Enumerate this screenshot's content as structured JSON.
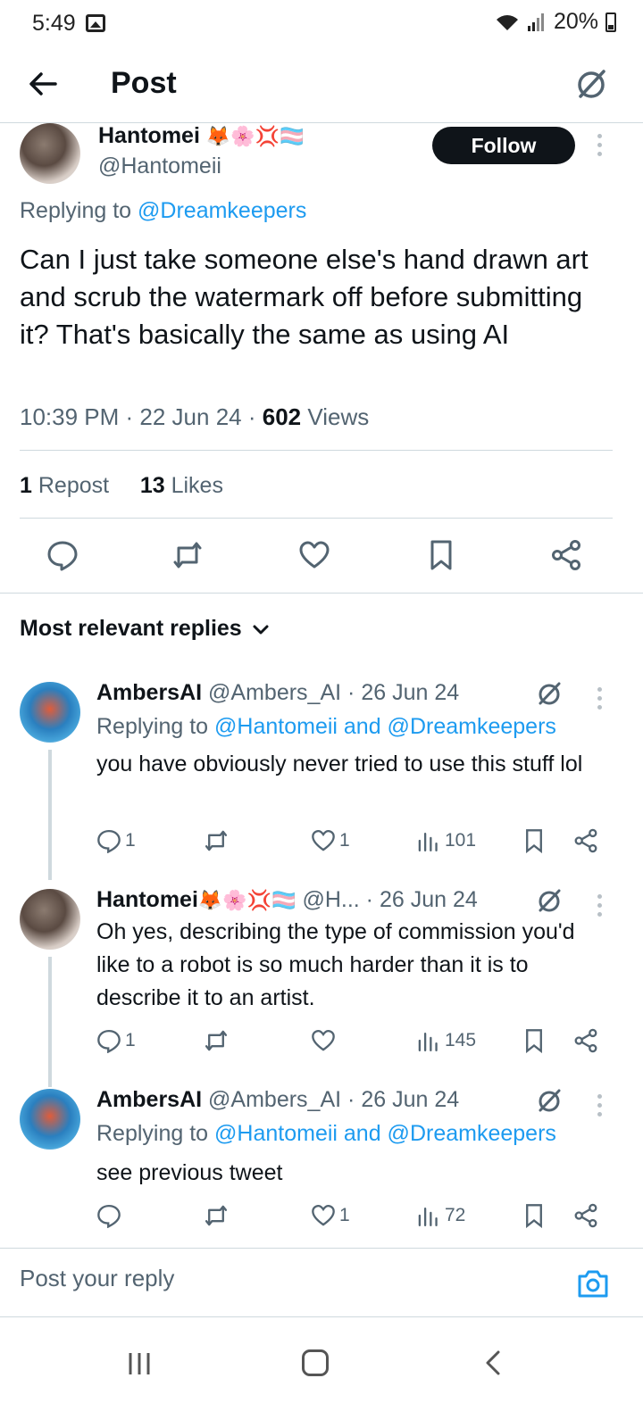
{
  "status_bar": {
    "time": "5:49",
    "battery": "20%"
  },
  "header": {
    "title": "Post"
  },
  "main_post": {
    "author_name": "Hantomei",
    "author_emojis": "🦊🌸💢🏳️‍⚧️",
    "author_handle": "@Hantomeii",
    "follow_label": "Follow",
    "replying_prefix": "Replying to ",
    "replying_to": "@Dreamkeepers",
    "text": "Can I just take someone else's hand drawn art and scrub the watermark off before submitting it? That's basically the same as using AI",
    "time": "10:39 PM",
    "date": "22 Jun 24",
    "views_count": "602",
    "views_label": "Views",
    "reposts_count": "1",
    "reposts_label": "Repost",
    "likes_count": "13",
    "likes_label": "Likes"
  },
  "replies_header": {
    "label": "Most relevant replies"
  },
  "replies": [
    {
      "author_name": "AmbersAI",
      "author_emojis": "",
      "author_handle": "@Ambers_AI",
      "date": "26 Jun 24",
      "replying_prefix": "Replying to ",
      "replying_to": "@Hantomeii and @Dreamkeepers",
      "text": "you have obviously never tried to use this stuff lol",
      "replies_count": "1",
      "reposts_count": "",
      "likes_count": "1",
      "views_count": "101"
    },
    {
      "author_name": "Hantomei",
      "author_emojis": "🦊🌸💢🏳️‍⚧️",
      "author_handle": "@H...",
      "date": "26 Jun 24",
      "replying_prefix": "",
      "replying_to": "",
      "text": "Oh yes, describing the type of commission you'd like to a robot is so much harder than it is to describe it to an artist.",
      "replies_count": "1",
      "reposts_count": "",
      "likes_count": "",
      "views_count": "145"
    },
    {
      "author_name": "AmbersAI",
      "author_emojis": "",
      "author_handle": "@Ambers_AI",
      "date": "26 Jun 24",
      "replying_prefix": "Replying to ",
      "replying_to": "@Hantomeii and @Dreamkeepers",
      "text": "see previous tweet",
      "replies_count": "",
      "reposts_count": "",
      "likes_count": "1",
      "views_count": "72"
    }
  ],
  "reply_bar": {
    "placeholder": "Post your reply"
  },
  "colors": {
    "accent": "#1d9bf0",
    "text": "#0f1419",
    "muted": "#536471",
    "border": "#cfd9de"
  },
  "icons": [
    "back-arrow-icon",
    "grok-icon",
    "reply-icon",
    "repost-icon",
    "like-icon",
    "bookmark-icon",
    "share-icon",
    "views-icon",
    "camera-icon",
    "chevron-down-icon"
  ]
}
